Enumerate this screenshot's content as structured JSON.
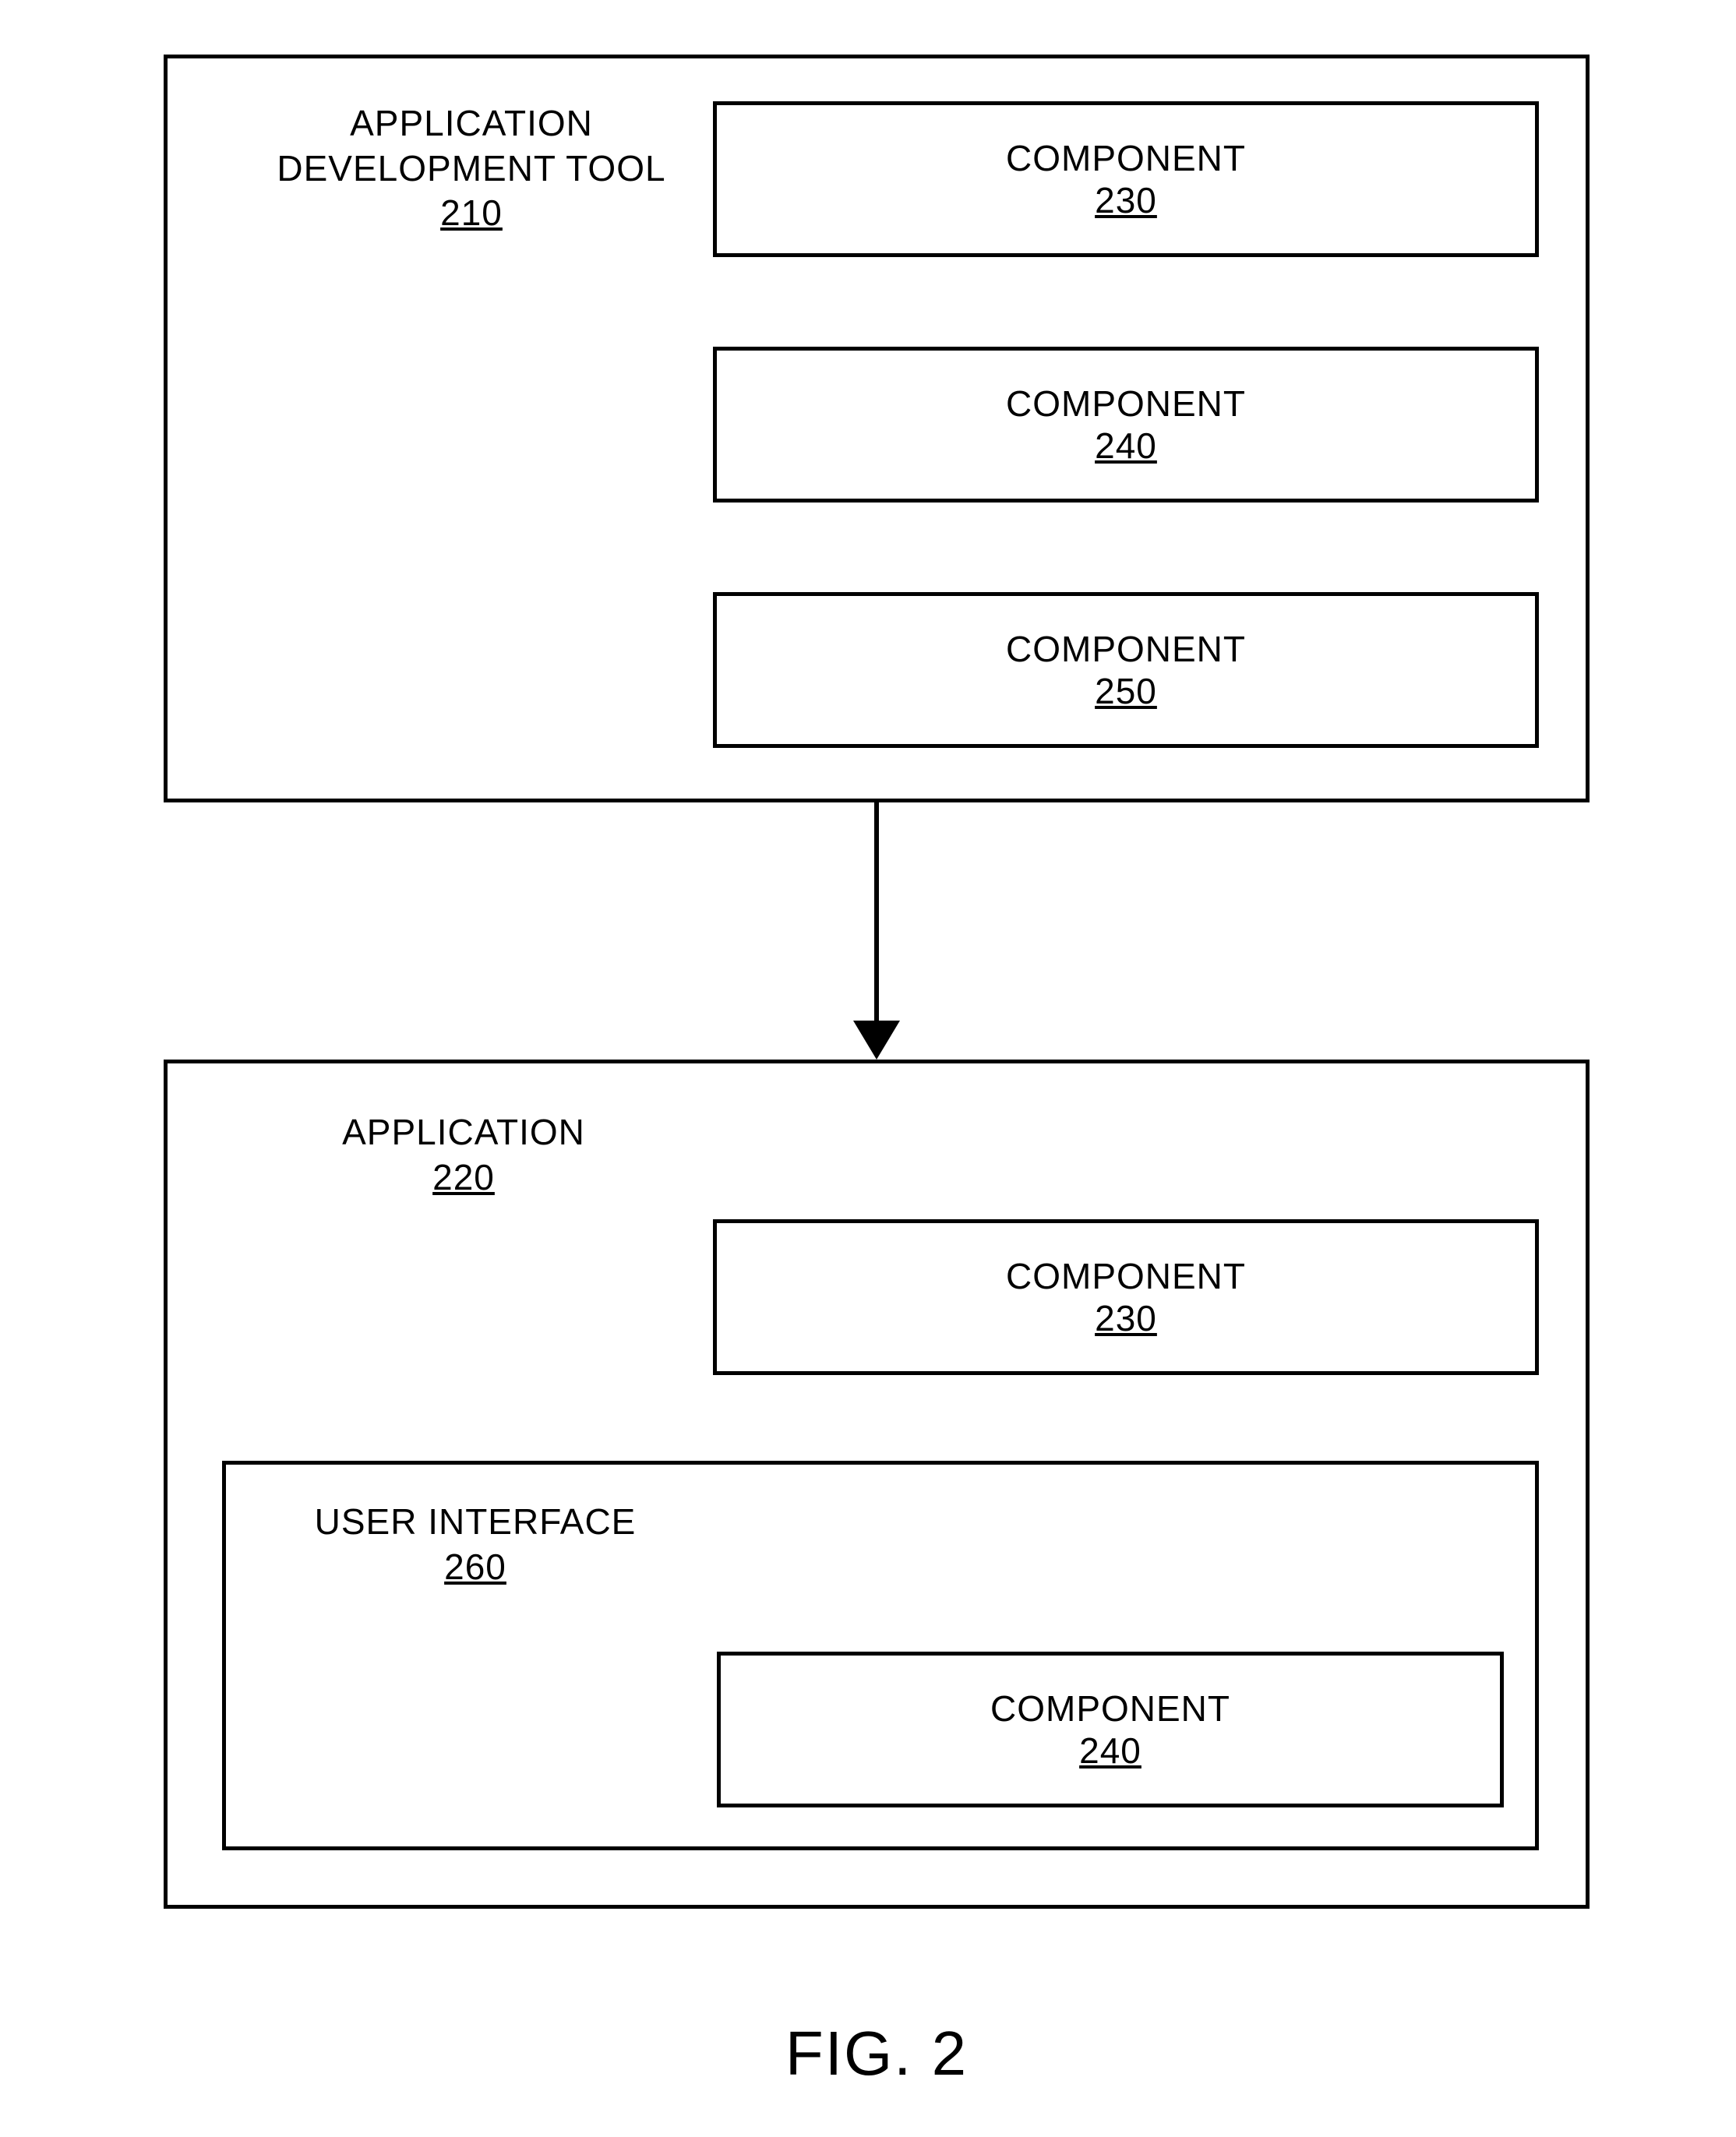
{
  "top": {
    "title_line1": "APPLICATION",
    "title_line2": "DEVELOPMENT TOOL",
    "title_num": "210",
    "components": [
      {
        "label": "COMPONENT",
        "num": "230"
      },
      {
        "label": "COMPONENT",
        "num": "240"
      },
      {
        "label": "COMPONENT",
        "num": "250"
      }
    ]
  },
  "bottom": {
    "title_line1": "APPLICATION",
    "title_num": "220",
    "comp_a_label": "COMPONENT",
    "comp_a_num": "230",
    "ui_title": "USER INTERFACE",
    "ui_num": "260",
    "comp_b_label": "COMPONENT",
    "comp_b_num": "240"
  },
  "figure_caption": "FIG. 2",
  "chart_data": {
    "type": "diagram",
    "title": "FIG. 2",
    "nodes": [
      {
        "id": "210",
        "label": "APPLICATION DEVELOPMENT TOOL",
        "contains": [
          "230",
          "240",
          "250"
        ]
      },
      {
        "id": "230",
        "label": "COMPONENT"
      },
      {
        "id": "240",
        "label": "COMPONENT"
      },
      {
        "id": "250",
        "label": "COMPONENT"
      },
      {
        "id": "220",
        "label": "APPLICATION",
        "contains": [
          "230",
          "260"
        ]
      },
      {
        "id": "260",
        "label": "USER INTERFACE",
        "contains": [
          "240"
        ]
      }
    ],
    "edges": [
      {
        "from": "210",
        "to": "220",
        "type": "arrow"
      }
    ]
  }
}
